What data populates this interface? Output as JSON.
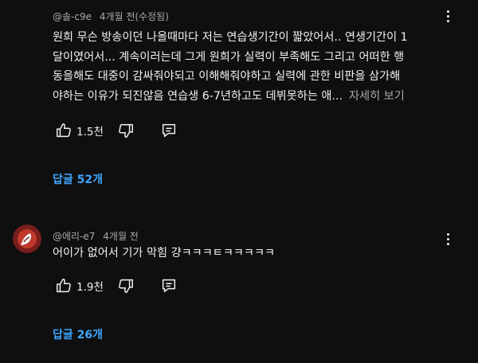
{
  "comments": [
    {
      "author": "@솔-c9e",
      "time": "4개월 전(수정됨)",
      "lines": [
        "원희 무슨 방송이던 나올때마다 저는 연습생기간이 짧았어서.. 연생기간이 1",
        "달이였어서... 계속이러는데 그게 원희가 실력이 부족해도 그리고  어떠한 행",
        "동을해도 대중이 감싸줘야되고  이해해줘야하고 실력에 관한 비판을 삼가해",
        "야하는 이유가 되진않음 연습생 6-7년하고도 데뷔못하는 애..."
      ],
      "read_more": "자세히 보기",
      "likes": "1.5천",
      "replies": "답글 52개",
      "avatar_icon": "none"
    },
    {
      "author": "@에리-e7",
      "time": "4개월 전",
      "lines": [
        "어이가 없어서 기가 막힘 걍ㅋㅋㅋㅌㅋㅋㅋㅋㅋ"
      ],
      "likes": "1.9천",
      "replies": "답글 26개",
      "avatar_icon": "profile-avatar"
    }
  ],
  "icons": {
    "like": "thumbs-up-icon",
    "dislike": "thumbs-down-icon",
    "reply": "reply-icon",
    "more": "more-vert-icon"
  },
  "colors": {
    "background": "#0f0f0f",
    "text": "#f1f1f1",
    "secondary_text": "#aaaaaa",
    "link": "#3ea6ff"
  }
}
